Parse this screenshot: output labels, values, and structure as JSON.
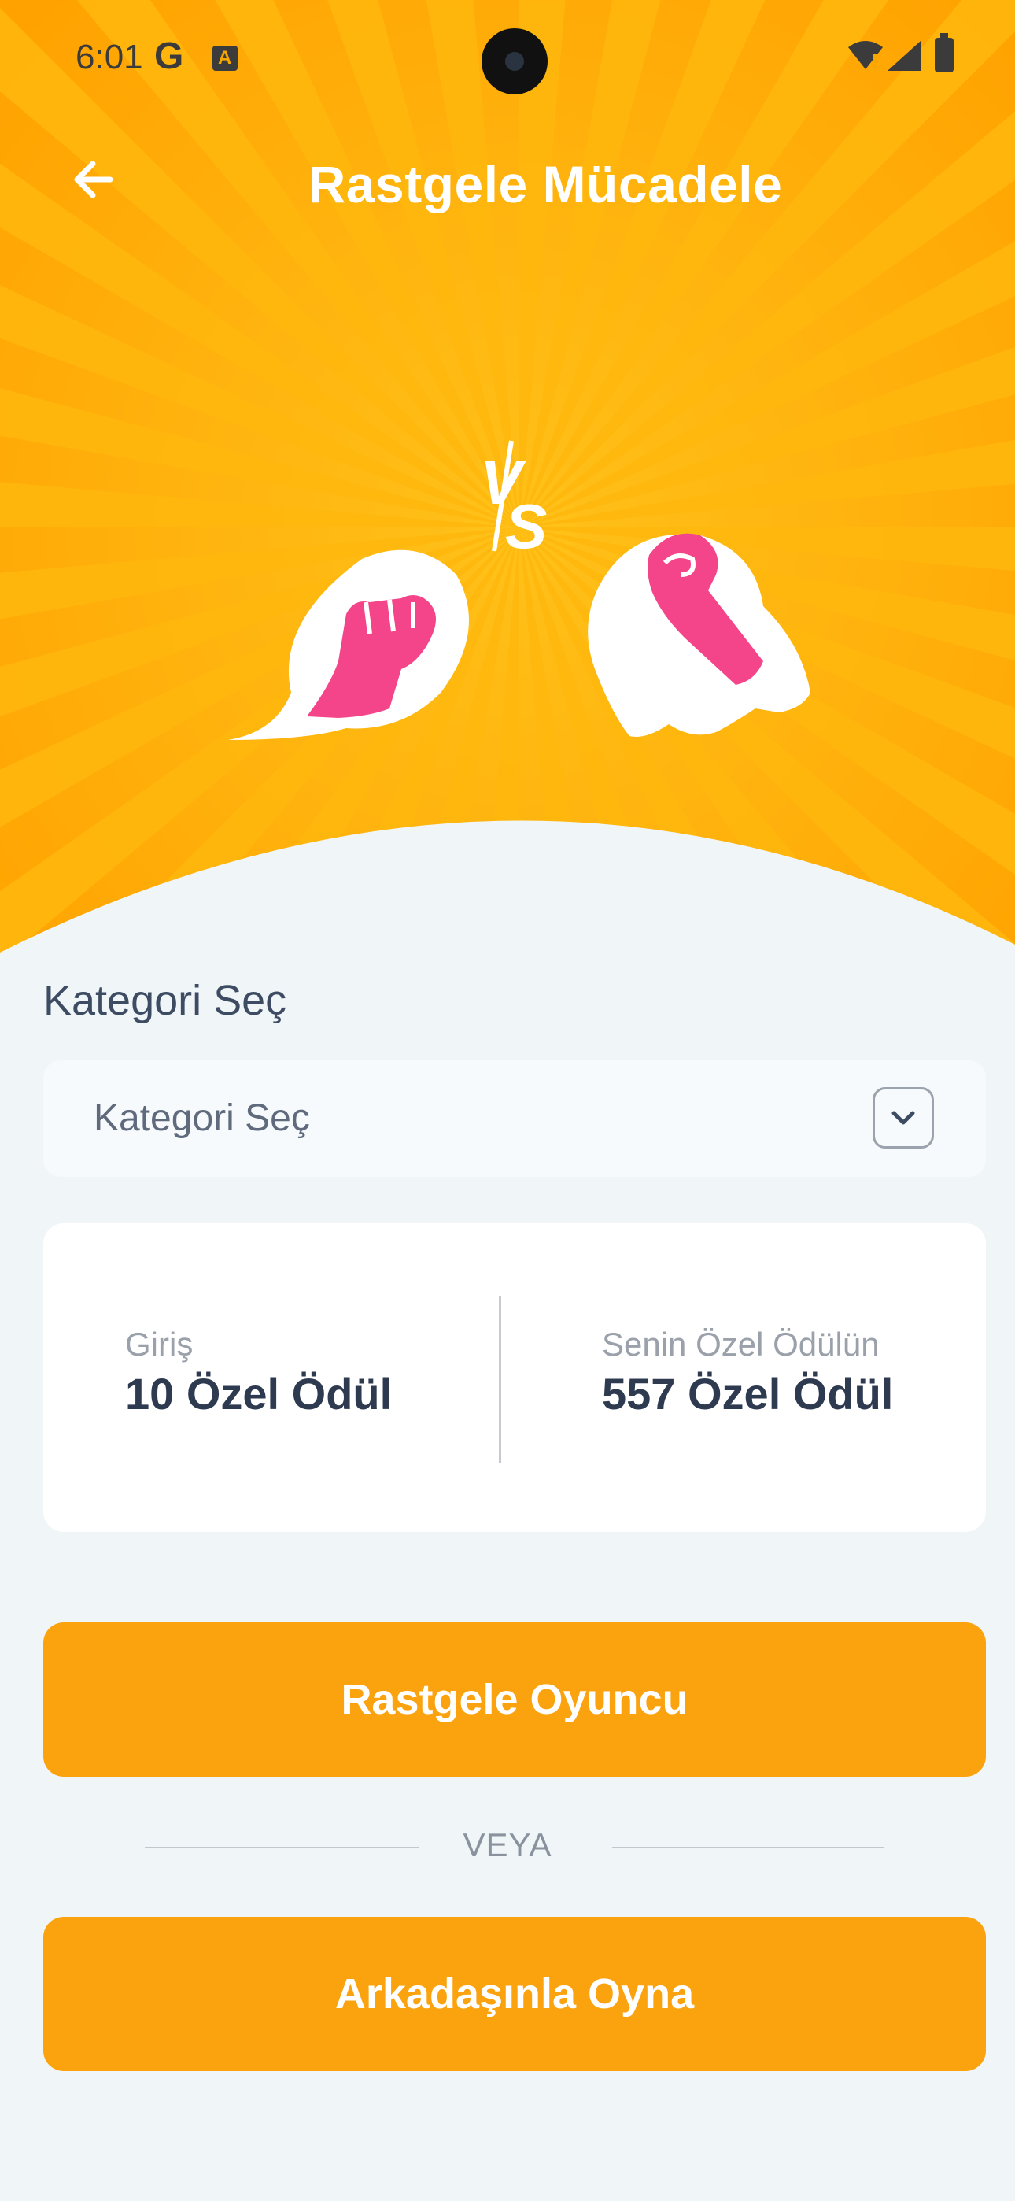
{
  "status_bar": {
    "time": "6:01",
    "google_glyph": "G"
  },
  "app_bar": {
    "title": "Rastgele Mücadele",
    "back_icon": "arrow-left-icon"
  },
  "illustration": {
    "vs_text": "VS",
    "colors": {
      "fist": "#f4458a",
      "flame": "#ffffff"
    }
  },
  "category": {
    "section_label": "Kategori Seç",
    "select_placeholder": "Kategori Seç"
  },
  "info": {
    "entry_label": "Giriş",
    "entry_value": "10 Özel Ödül",
    "reward_label": "Senin Özel Ödülün",
    "reward_value": "557 Özel Ödül"
  },
  "actions": {
    "random_player_label": "Rastgele Oyuncu",
    "or_text": "VEYA",
    "play_with_friend_label": "Arkadaşınla Oyna"
  },
  "colors": {
    "accent": "#fba30f",
    "hero_bg": "#ffab00",
    "page_bg": "#f0f5f8",
    "text_dark": "#2e3a50"
  }
}
